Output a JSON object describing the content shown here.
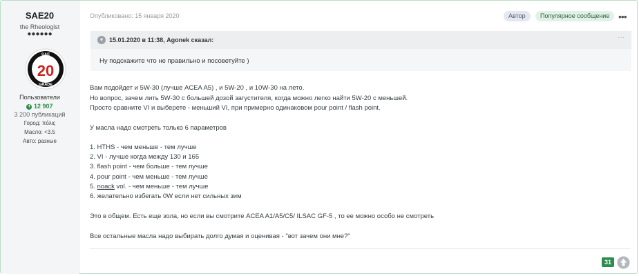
{
  "author": {
    "name": "SAE20",
    "title": "the Rheologist",
    "rank_dots": "●●●●●●",
    "avatar_text": {
      "top": "SAE",
      "number": "20",
      "bottom": "GRADE"
    },
    "group": "Пользователи",
    "reputation": "12 907",
    "post_count": "3 200 публикаций",
    "fields": [
      "Город: πόλις",
      "Масло: <3.5",
      "Авто: разные"
    ]
  },
  "post": {
    "date": "Опубликовано: 15 января 2020",
    "badges": {
      "author": "Автор",
      "popular": "Популярное сообщение"
    },
    "more_icon": "•••",
    "quote": {
      "cite": "15.01.2020 в 11:38, Agonek сказал:",
      "text": "Ну подскажите что не правильно и посоветуйте )"
    },
    "paragraphs": [
      "Вам подойдет и 5W-30 (лучше ACEA A5) , и 5W-20 , и 10W-30 на лето.",
      "Но вопрос, зачем лить 5W-30 с большей дозой загустителя, когда можно легко найти 5W-20 с меньшей.",
      "Просто сравните VI и выберете - меньший VI, при примерно одинаковом pour point / flash point.",
      "У масла надо смотреть только 6 параметров",
      "1. HTHS - чем меньше - тем лучше",
      "2. VI - лучше когда между 130 и 165",
      "3. flash point - чем больше - тем лучше",
      "4. pour point - чем меньше - тем лучше",
      "6. желательно избегать 0W если нет сильных зим",
      "Это в общем. Есть еще зола, но если вы смотрите ACEA A1/A5/C5/ ILSAC GF-5 , то ее можно особо не смотреть",
      "Все остальные масла надо выбирать долго думая и оценивая - \"вот зачем они мне?\""
    ],
    "item5": {
      "prefix": "5. ",
      "link": "noack",
      "suffix": " vol. - чем меньше - тем лучше"
    },
    "like_count": "31"
  },
  "colors": {
    "accent_green": "#2e8d4d",
    "border": "#b9dcc5"
  }
}
